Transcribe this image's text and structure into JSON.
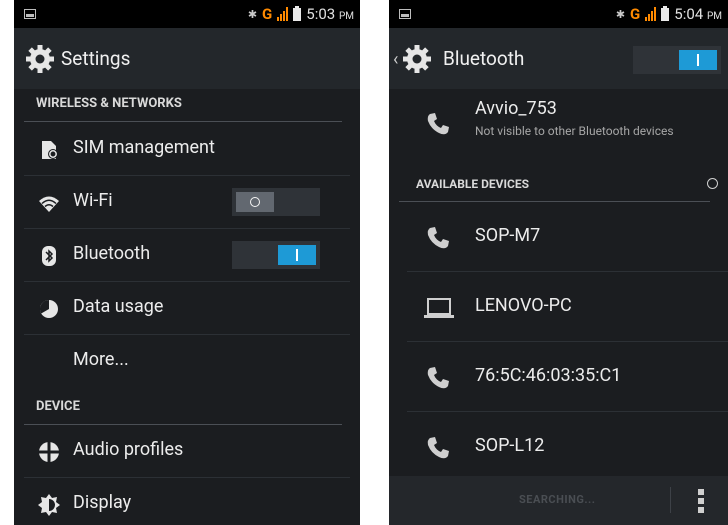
{
  "left_screen": {
    "status": {
      "time": "5:03",
      "ampm": "PM",
      "network_letter": "G"
    },
    "title": "Settings",
    "sections": {
      "wireless": "WIRELESS & NETWORKS",
      "device": "DEVICE"
    },
    "items": {
      "sim": "SIM management",
      "wifi": "Wi-Fi",
      "bluetooth": "Bluetooth",
      "data": "Data usage",
      "more": "More...",
      "audio": "Audio profiles",
      "display": "Display"
    },
    "toggles": {
      "wifi": "off",
      "bluetooth": "on"
    }
  },
  "right_screen": {
    "status": {
      "time": "5:04",
      "ampm": "PM",
      "network_letter": "G"
    },
    "title": "Bluetooth",
    "bluetooth_toggle": "on",
    "my_device": {
      "name": "Avvio_753",
      "subtitle": "Not visible to other Bluetooth devices"
    },
    "available_header": "AVAILABLE DEVICES",
    "devices": [
      {
        "name": "SOP-M7",
        "icon": "phone-icon"
      },
      {
        "name": "LENOVO-PC",
        "icon": "laptop-icon"
      },
      {
        "name": "76:5C:46:03:35:C1",
        "icon": "phone-icon"
      },
      {
        "name": "SOP-L12",
        "icon": "phone-icon"
      }
    ],
    "bottom_action": "SEARCHING..."
  },
  "colors": {
    "accent": "#1e9ad6",
    "network": "#ff8a00",
    "background": "#1b1d20"
  }
}
